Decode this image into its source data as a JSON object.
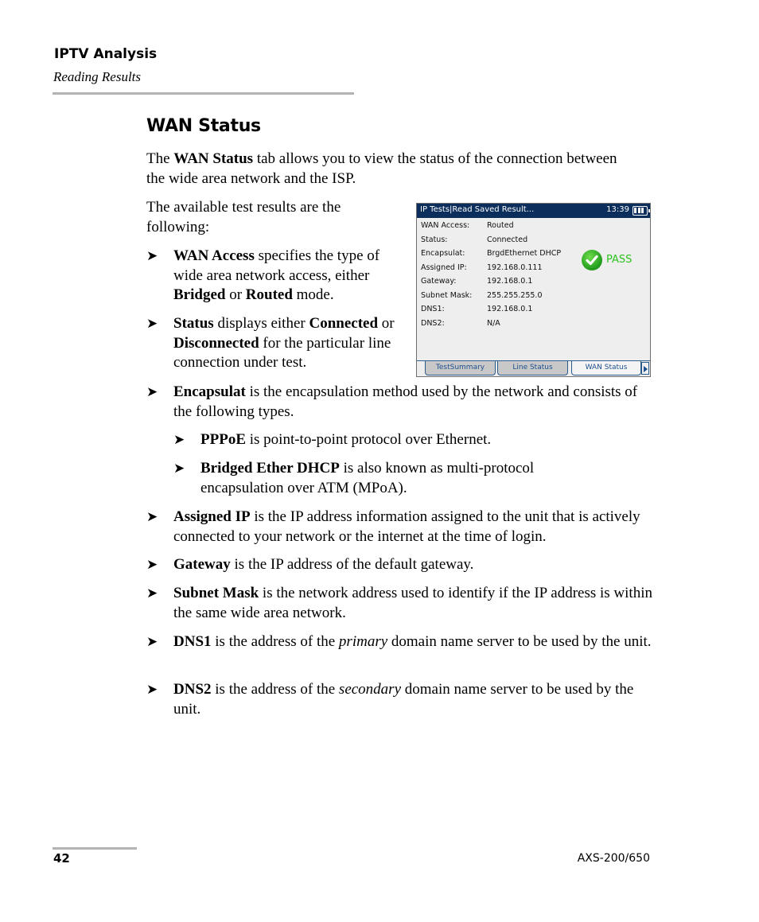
{
  "header": {
    "chapter": "IPTV Analysis",
    "section": "Reading Results"
  },
  "section_title": "WAN Status",
  "intro": {
    "pre": "The ",
    "bold": "WAN Status",
    "post": " tab allows you to view the status of the connection between the wide area network and the ISP."
  },
  "available_text": "The available test results are the following:",
  "bullets": [
    {
      "term": "WAN Access",
      "text_a": " specifies the type of wide area network access, either ",
      "b1": "Bridged",
      "mid": " or ",
      "b2": "Routed",
      "text_b": " mode."
    },
    {
      "term": "Status",
      "text_a": " displays either ",
      "b1": "Connected",
      "mid": " or ",
      "b2": "Disconnected",
      "text_b": " for the particular line connection under test."
    },
    {
      "term": "Encapsulat",
      "text": " is the encapsulation method used by the network and consists of the following types."
    },
    {
      "term": "Assigned IP",
      "text": " is the IP address information assigned to the unit that is actively connected to your network or the internet at the time of login."
    },
    {
      "term": "Gateway",
      "text": " is the IP address of the default gateway."
    },
    {
      "term": "Subnet Mask",
      "text": " is the network address used to identify if the IP address is within the same wide area network."
    },
    {
      "term": "DNS1",
      "text_a": " is the address of the ",
      "em": "primary",
      "text_b": " domain name server to be used by the unit."
    },
    {
      "term": "DNS2",
      "text_a": " is the address of the ",
      "em": "secondary",
      "text_b": " domain name server to be used by the unit."
    }
  ],
  "sub_bullets": [
    {
      "term": "PPPoE",
      "text": " is point-to-point protocol over Ethernet."
    },
    {
      "term": "Bridged Ether DHCP",
      "text": " is also known as multi-protocol encapsulation over ATM (MPoA)."
    }
  ],
  "arrow_glyph": "➤",
  "device": {
    "title": "IP Tests|Read Saved Result...",
    "time": "13:39",
    "battery_icon": "battery-full-icon",
    "rows": [
      {
        "label": "WAN Access:",
        "value": "Routed"
      },
      {
        "label": "Status:",
        "value": "Connected"
      },
      {
        "label": "Encapsulat:",
        "value": "BrgdEthernet DHCP"
      },
      {
        "label": "Assigned IP:",
        "value": "192.168.0.111"
      },
      {
        "label": "Gateway:",
        "value": "192.168.0.1"
      },
      {
        "label": "Subnet Mask:",
        "value": "255.255.255.0"
      },
      {
        "label": "DNS1:",
        "value": "192.168.0.1"
      },
      {
        "label": "DNS2:",
        "value": "N/A"
      }
    ],
    "result": "PASS",
    "result_color": "#2bc41c",
    "titlebar_color": "#0b2e5c",
    "tabs": [
      {
        "label": "TestSummary",
        "active": false
      },
      {
        "label": "Line Status",
        "active": false
      },
      {
        "label": "WAN Status",
        "active": true
      }
    ]
  },
  "footer": {
    "page_number": "42",
    "model": "AXS-200/650"
  }
}
